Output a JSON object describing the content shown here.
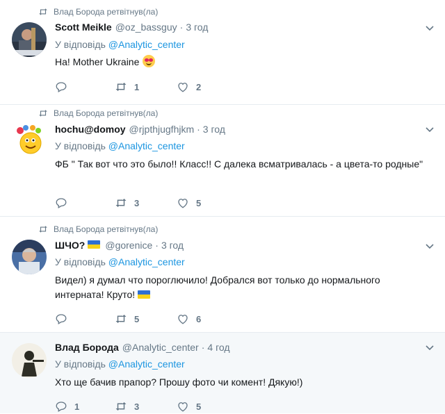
{
  "tweets": [
    {
      "retweeted_by": "Влад Борода ретвітнув(ла)",
      "name": "Scott Meikle",
      "handle": "@oz_bassguy",
      "time": "3 год",
      "reply_prefix": "У відповідь",
      "reply_to": "@Analytic_center",
      "text": "На! Mother Ukraine",
      "replies": "",
      "retweets": "1",
      "likes": "2"
    },
    {
      "retweeted_by": "Влад Борода ретвітнув(ла)",
      "name": "hochu@domoy",
      "handle": "@rjpthjugfhjkm",
      "time": "3 год",
      "reply_prefix": "У відповідь",
      "reply_to": "@Analytic_center",
      "text": "ФБ \" Так вот что это было!! Класс!! С далека всматривалась - а цвета-то родные\"",
      "replies": "",
      "retweets": "3",
      "likes": "5"
    },
    {
      "retweeted_by": "Влад Борода ретвітнув(ла)",
      "name": "ШЧО?",
      "handle": "@gorenice",
      "time": "3 год",
      "reply_prefix": "У відповідь",
      "reply_to": "@Analytic_center",
      "text": "Видел) я думал что пороглючило! Добрался вот только до нормального интерната! Круто!",
      "replies": "",
      "retweets": "5",
      "likes": "6"
    },
    {
      "name": "Влад Борода",
      "handle": "@Analytic_center",
      "time": "4 год",
      "reply_prefix": "У відповідь",
      "reply_to": "@Analytic_center",
      "text": "Хто ще бачив прапор? Прошу фото чи комент! Дякую!)",
      "replies": "1",
      "retweets": "3",
      "likes": "5"
    }
  ],
  "icons": {
    "retweet": "retweet-icon",
    "reply": "reply-icon",
    "like": "heart-icon",
    "more": "chevron-down-icon"
  },
  "colors": {
    "link": "#1b95e0",
    "muted": "#657786",
    "highlight_bg": "#f5f8fa"
  }
}
